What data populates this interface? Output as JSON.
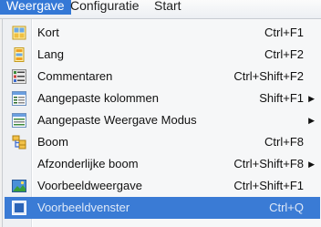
{
  "menubar": {
    "items": [
      {
        "label": "Weergave"
      },
      {
        "label": "Configuratie"
      },
      {
        "label": "Start"
      }
    ]
  },
  "menu": {
    "items": [
      {
        "label": "Kort",
        "shortcut": "Ctrl+F1",
        "icon": "short-view-icon",
        "submenu": ""
      },
      {
        "label": "Lang",
        "shortcut": "Ctrl+F2",
        "icon": "long-view-icon",
        "submenu": ""
      },
      {
        "label": "Commentaren",
        "shortcut": "Ctrl+Shift+F2",
        "icon": "comments-icon",
        "submenu": ""
      },
      {
        "label": "Aangepaste kolommen",
        "shortcut": "Shift+F1",
        "icon": "custom-columns-icon",
        "submenu": "▶"
      },
      {
        "label": "Aangepaste Weergave Modus",
        "shortcut": "",
        "icon": "custom-view-mode-icon",
        "submenu": "▶"
      },
      {
        "label": "Boom",
        "shortcut": "Ctrl+F8",
        "icon": "tree-icon",
        "submenu": ""
      },
      {
        "label": "Afzonderlijke boom",
        "shortcut": "Ctrl+Shift+F8",
        "icon": "",
        "submenu": "▶"
      },
      {
        "label": "Voorbeeldweergave",
        "shortcut": "Ctrl+Shift+F1",
        "icon": "thumbnail-view-icon",
        "submenu": ""
      },
      {
        "label": "Voorbeeldvenster",
        "shortcut": "Ctrl+Q",
        "icon": "quick-view-icon",
        "submenu": ""
      }
    ]
  }
}
